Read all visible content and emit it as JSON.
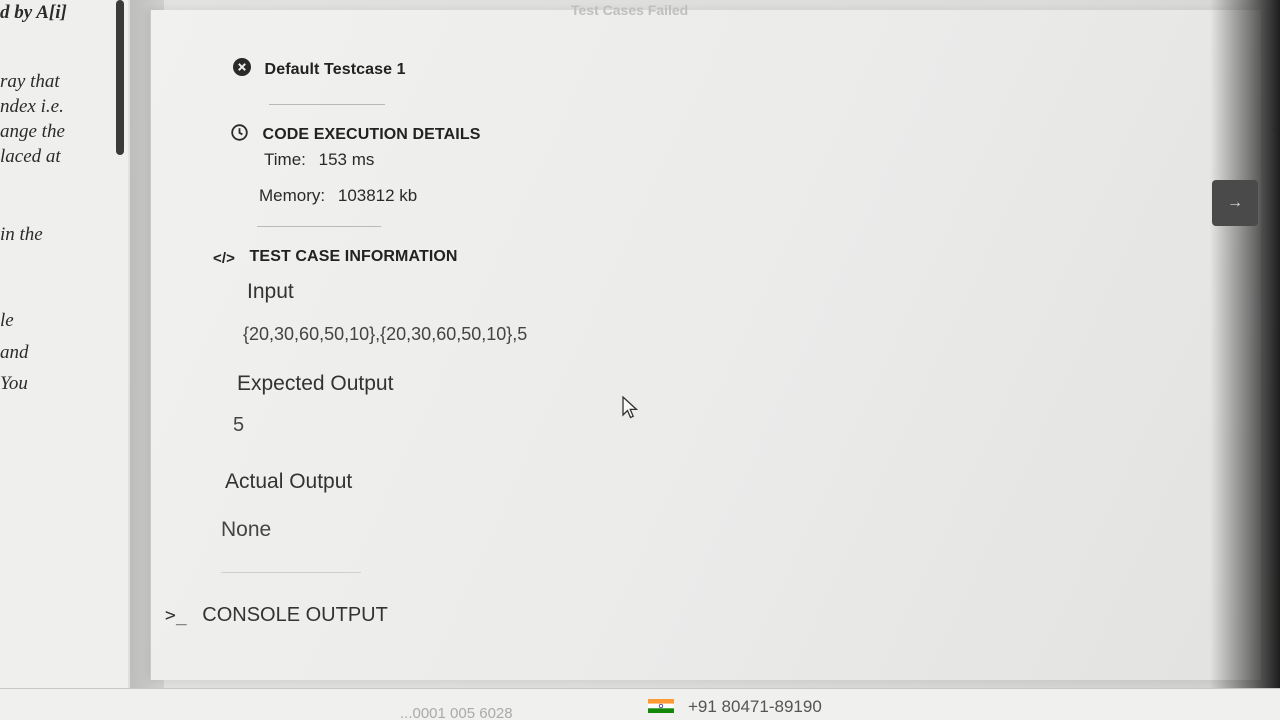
{
  "left_pane": {
    "lines": [
      "d by A[i]",
      "ray that",
      "ndex i.e.",
      "ange the",
      "laced at",
      "in the",
      "le",
      "and",
      "You"
    ]
  },
  "modal": {
    "top_text": "Test Cases Failed",
    "testcase": {
      "title": "Default Testcase 1",
      "status_icon": "error-circle-icon"
    },
    "execution": {
      "header": "CODE EXECUTION DETAILS",
      "time_label": "Time:",
      "time_value": "153 ms",
      "memory_label": "Memory:",
      "memory_value": "103812 kb"
    },
    "testinfo": {
      "header": "TEST CASE INFORMATION",
      "input_label": "Input",
      "input_value": "{20,30,60,50,10},{20,30,60,50,10},5",
      "expected_label": "Expected Output",
      "expected_value": "5",
      "actual_label": "Actual Output",
      "actual_value": "None"
    },
    "console": {
      "prompt": ">_",
      "header": "CONSOLE OUTPUT"
    }
  },
  "side_tab": {
    "icon": "arrow-right-icon",
    "glyph": "→"
  },
  "footer": {
    "phone": "+91 80471-89190",
    "phone_partial": "...0001 005 6028"
  },
  "colors": {
    "error": "#2a2a2a",
    "text": "#222222",
    "muted": "#b9b9b7"
  }
}
